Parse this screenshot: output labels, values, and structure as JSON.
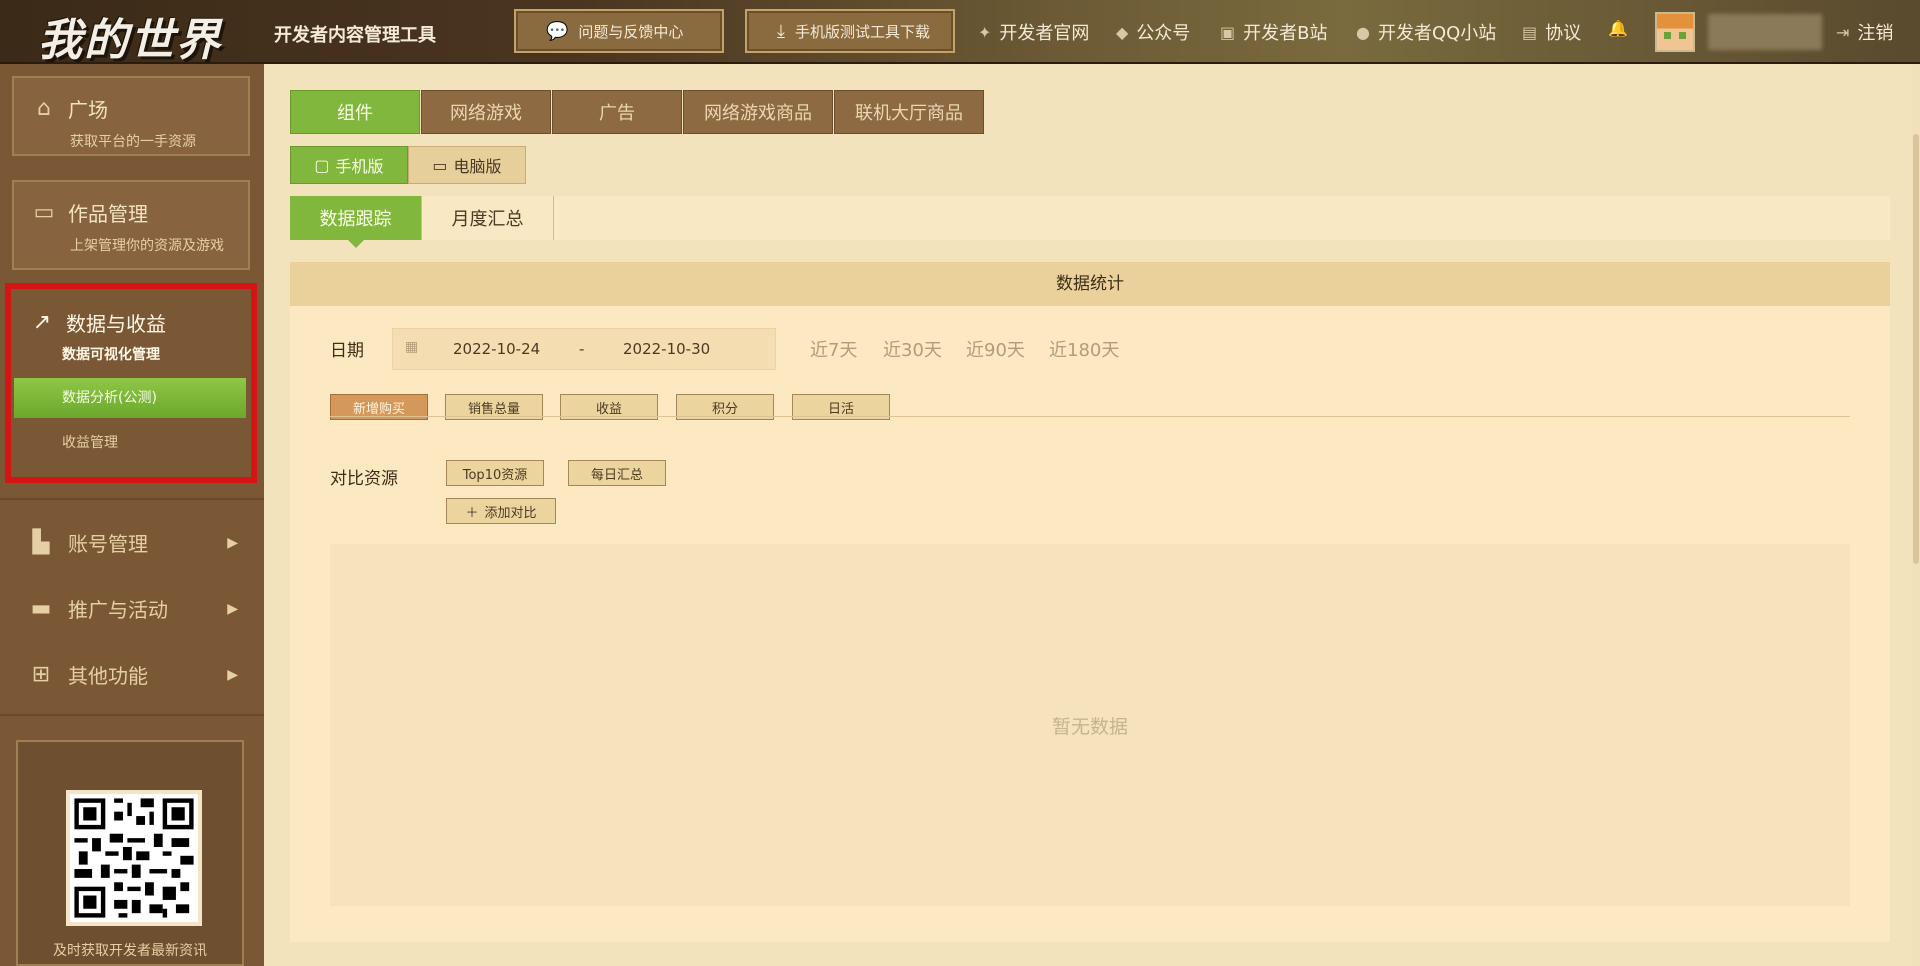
{
  "header": {
    "logo": "我的世界",
    "app_title": "开发者内容管理工具",
    "feedback_button": "问题与反馈中心",
    "mobile_tool_button": "手机版测试工具下载",
    "links": {
      "official_site": "开发者官网",
      "wechat": "公众号",
      "bilibili": "开发者B站",
      "qq": "开发者QQ小站",
      "agreement": "协议"
    },
    "logout": "注销"
  },
  "sidebar": {
    "plaza": {
      "title": "广场",
      "subtitle": "获取平台的一手资源"
    },
    "works": {
      "title": "作品管理",
      "subtitle": "上架管理你的资源及游戏"
    },
    "data": {
      "title": "数据与收益",
      "subtitle": "数据可视化管理",
      "items": [
        "数据分析(公测)",
        "收益管理"
      ]
    },
    "nav": [
      "账号管理",
      "推广与活动",
      "其他功能"
    ],
    "qr_caption": "及时获取开发者最新资讯"
  },
  "main": {
    "tabs": [
      "组件",
      "网络游戏",
      "广告",
      "网络游戏商品",
      "联机大厅商品"
    ],
    "platform_tabs": [
      "手机版",
      "电脑版"
    ],
    "sub_tabs": [
      "数据跟踪",
      "月度汇总"
    ],
    "panel_title": "数据统计",
    "date_label": "日期",
    "date_start": "2022-10-24",
    "date_sep": "-",
    "date_end": "2022-10-30",
    "quick_ranges": [
      "近7天",
      "近30天",
      "近90天",
      "近180天"
    ],
    "metrics": [
      "新增购买",
      "销售总量",
      "收益",
      "积分",
      "日活"
    ],
    "compare_label": "对比资源",
    "compare_buttons": [
      "Top10资源",
      "每日汇总"
    ],
    "add_compare": "添加对比",
    "empty_text": "暂无数据"
  },
  "colors": {
    "accent_green": "#80b73c",
    "sidebar_brown": "#7a5836",
    "highlight_red": "#d71414",
    "metric_active": "#d4995a"
  }
}
